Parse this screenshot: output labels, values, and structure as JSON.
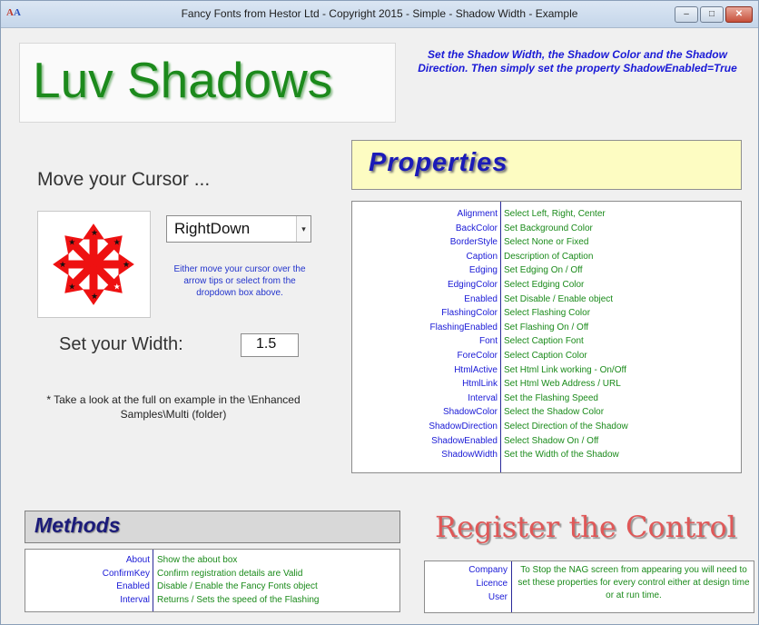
{
  "window": {
    "title": "Fancy Fonts from Hestor Ltd - Copyright 2015 - Simple - Shadow Width - Example",
    "icon_text": "AA",
    "minimize_icon": "minimize-icon",
    "maximize_icon": "maximize-icon",
    "close_icon": "close-icon"
  },
  "logo": {
    "text": "Luv Shadows"
  },
  "intro": {
    "text": "Set the Shadow Width, the Shadow Color and the Shadow Direction. Then simply set the property ShadowEnabled=True"
  },
  "move": {
    "label": "Move your Cursor ...",
    "direction_value": "RightDown",
    "help": "Either move your cursor over the arrow tips or select from the dropdown box above."
  },
  "width": {
    "label": "Set your Width:",
    "value": "1.5"
  },
  "note": {
    "text": "* Take a look at the full on example in the \\Enhanced Samples\\Multi (folder)"
  },
  "properties": {
    "title": "Properties",
    "rows": [
      {
        "name": "Alignment",
        "desc": "Select Left, Right, Center"
      },
      {
        "name": "BackColor",
        "desc": "Set Background Color"
      },
      {
        "name": "BorderStyle",
        "desc": "Select None or Fixed"
      },
      {
        "name": "Caption",
        "desc": "Description of Caption"
      },
      {
        "name": "Edging",
        "desc": "Set Edging On / Off"
      },
      {
        "name": "EdgingColor",
        "desc": "Select Edging Color"
      },
      {
        "name": "Enabled",
        "desc": "Set Disable / Enable object"
      },
      {
        "name": "FlashingColor",
        "desc": "Select Flashing Color"
      },
      {
        "name": "FlashingEnabled",
        "desc": "Set Flashing On / Off"
      },
      {
        "name": "Font",
        "desc": "Select Caption Font"
      },
      {
        "name": "ForeColor",
        "desc": "Select Caption Color"
      },
      {
        "name": "HtmlActive",
        "desc": "Set Html Link working - On/Off"
      },
      {
        "name": "HtmlLink",
        "desc": "Set Html Web Address / URL"
      },
      {
        "name": "Interval",
        "desc": "Set the Flashing Speed"
      },
      {
        "name": "ShadowColor",
        "desc": "Select the Shadow Color"
      },
      {
        "name": "ShadowDirection",
        "desc": "Select Direction of the Shadow"
      },
      {
        "name": "ShadowEnabled",
        "desc": "Select Shadow On / Off"
      },
      {
        "name": "ShadowWidth",
        "desc": "Set the Width of the Shadow"
      }
    ]
  },
  "methods": {
    "title": "Methods",
    "rows": [
      {
        "name": "About",
        "desc": "Show the about box"
      },
      {
        "name": "ConfirmKey",
        "desc": "Confirm registration details are Valid"
      },
      {
        "name": "Enabled",
        "desc": "Disable / Enable the Fancy Fonts object"
      },
      {
        "name": "Interval",
        "desc": "Returns / Sets the speed of the Flashing"
      }
    ]
  },
  "register": {
    "title": "Register the Control",
    "names": [
      "Company",
      "Licence",
      "User"
    ],
    "desc": "To Stop the NAG screen from appearing you will need to set these properties for every control either at design time or at run time."
  },
  "colors": {
    "logo_green": "#1c8a1c",
    "prop_name_blue": "#1a1ad6",
    "prop_desc_green": "#1a8a1a",
    "arrow_red": "#ee1111",
    "props_title_bg": "#fdfcc2",
    "register_red": "#e05858"
  }
}
